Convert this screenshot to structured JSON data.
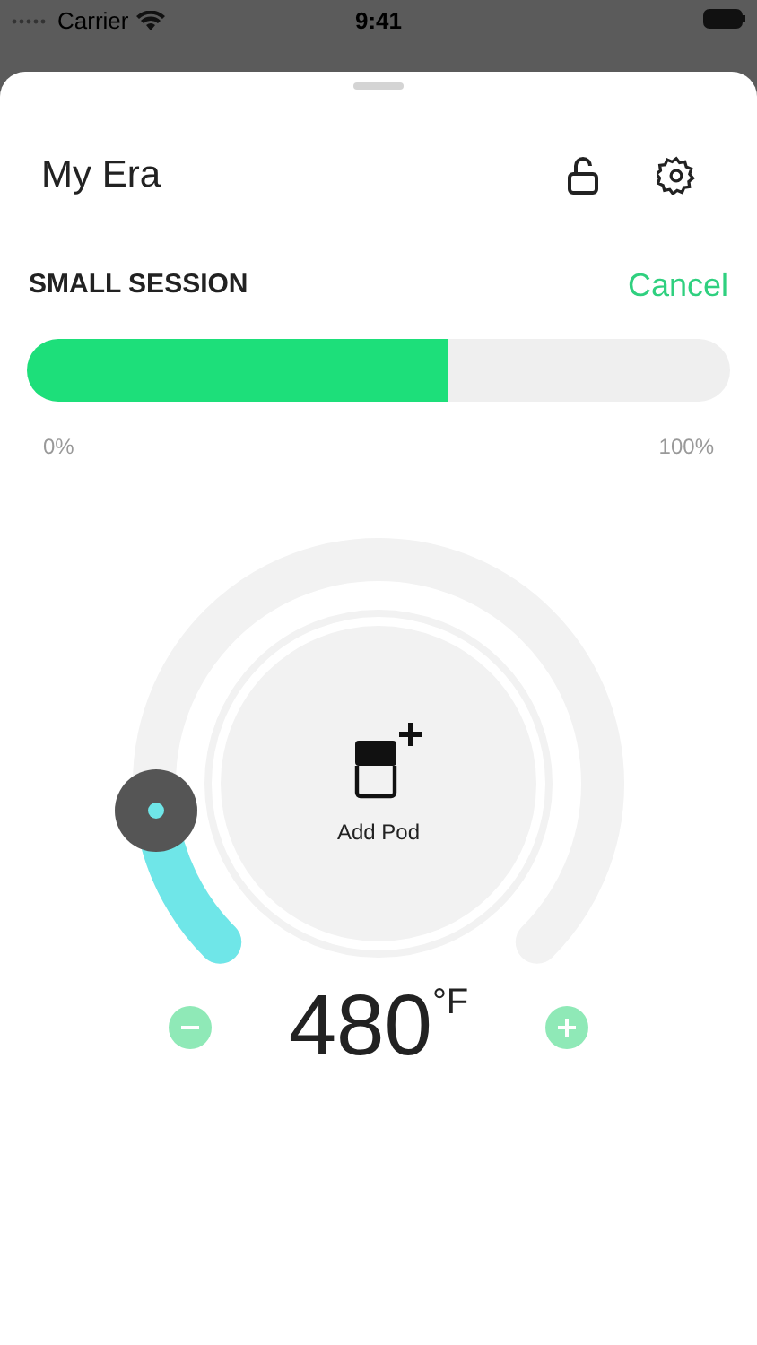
{
  "status_bar": {
    "carrier": "Carrier",
    "time": "9:41"
  },
  "header": {
    "title": "My Era"
  },
  "session": {
    "title": "SMALL SESSION",
    "cancel": "Cancel",
    "level": 0.6,
    "min_label": "0%",
    "max_label": "100%"
  },
  "dial": {
    "center_label": "Add Pod"
  },
  "temperature": {
    "value": "480",
    "unit": "°F"
  }
}
